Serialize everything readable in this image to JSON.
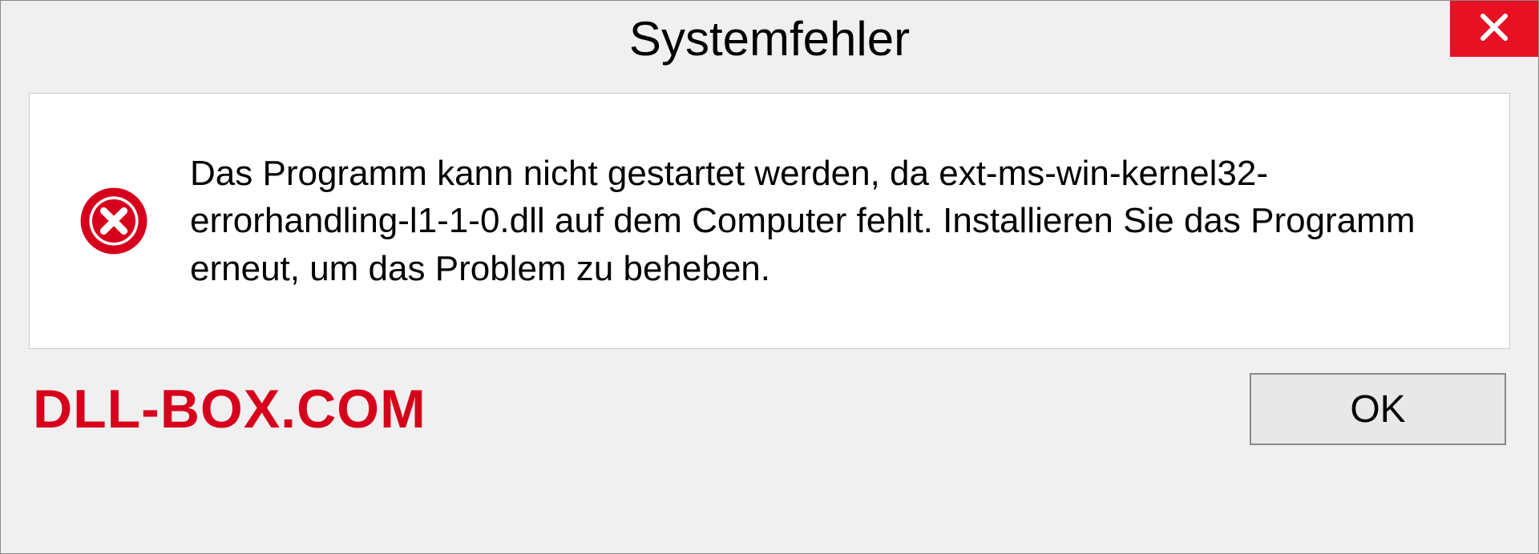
{
  "dialog": {
    "title": "Systemfehler",
    "message": "Das Programm kann nicht gestartet werden, da ext-ms-win-kernel32-errorhandling-l1-1-0.dll auf dem Computer fehlt. Installieren Sie das Programm erneut, um das Problem zu beheben.",
    "ok_label": "OK"
  },
  "watermark": "DLL-BOX.COM",
  "colors": {
    "close_bg": "#e81123",
    "watermark": "#d6001c",
    "error_icon": "#d6001c"
  }
}
